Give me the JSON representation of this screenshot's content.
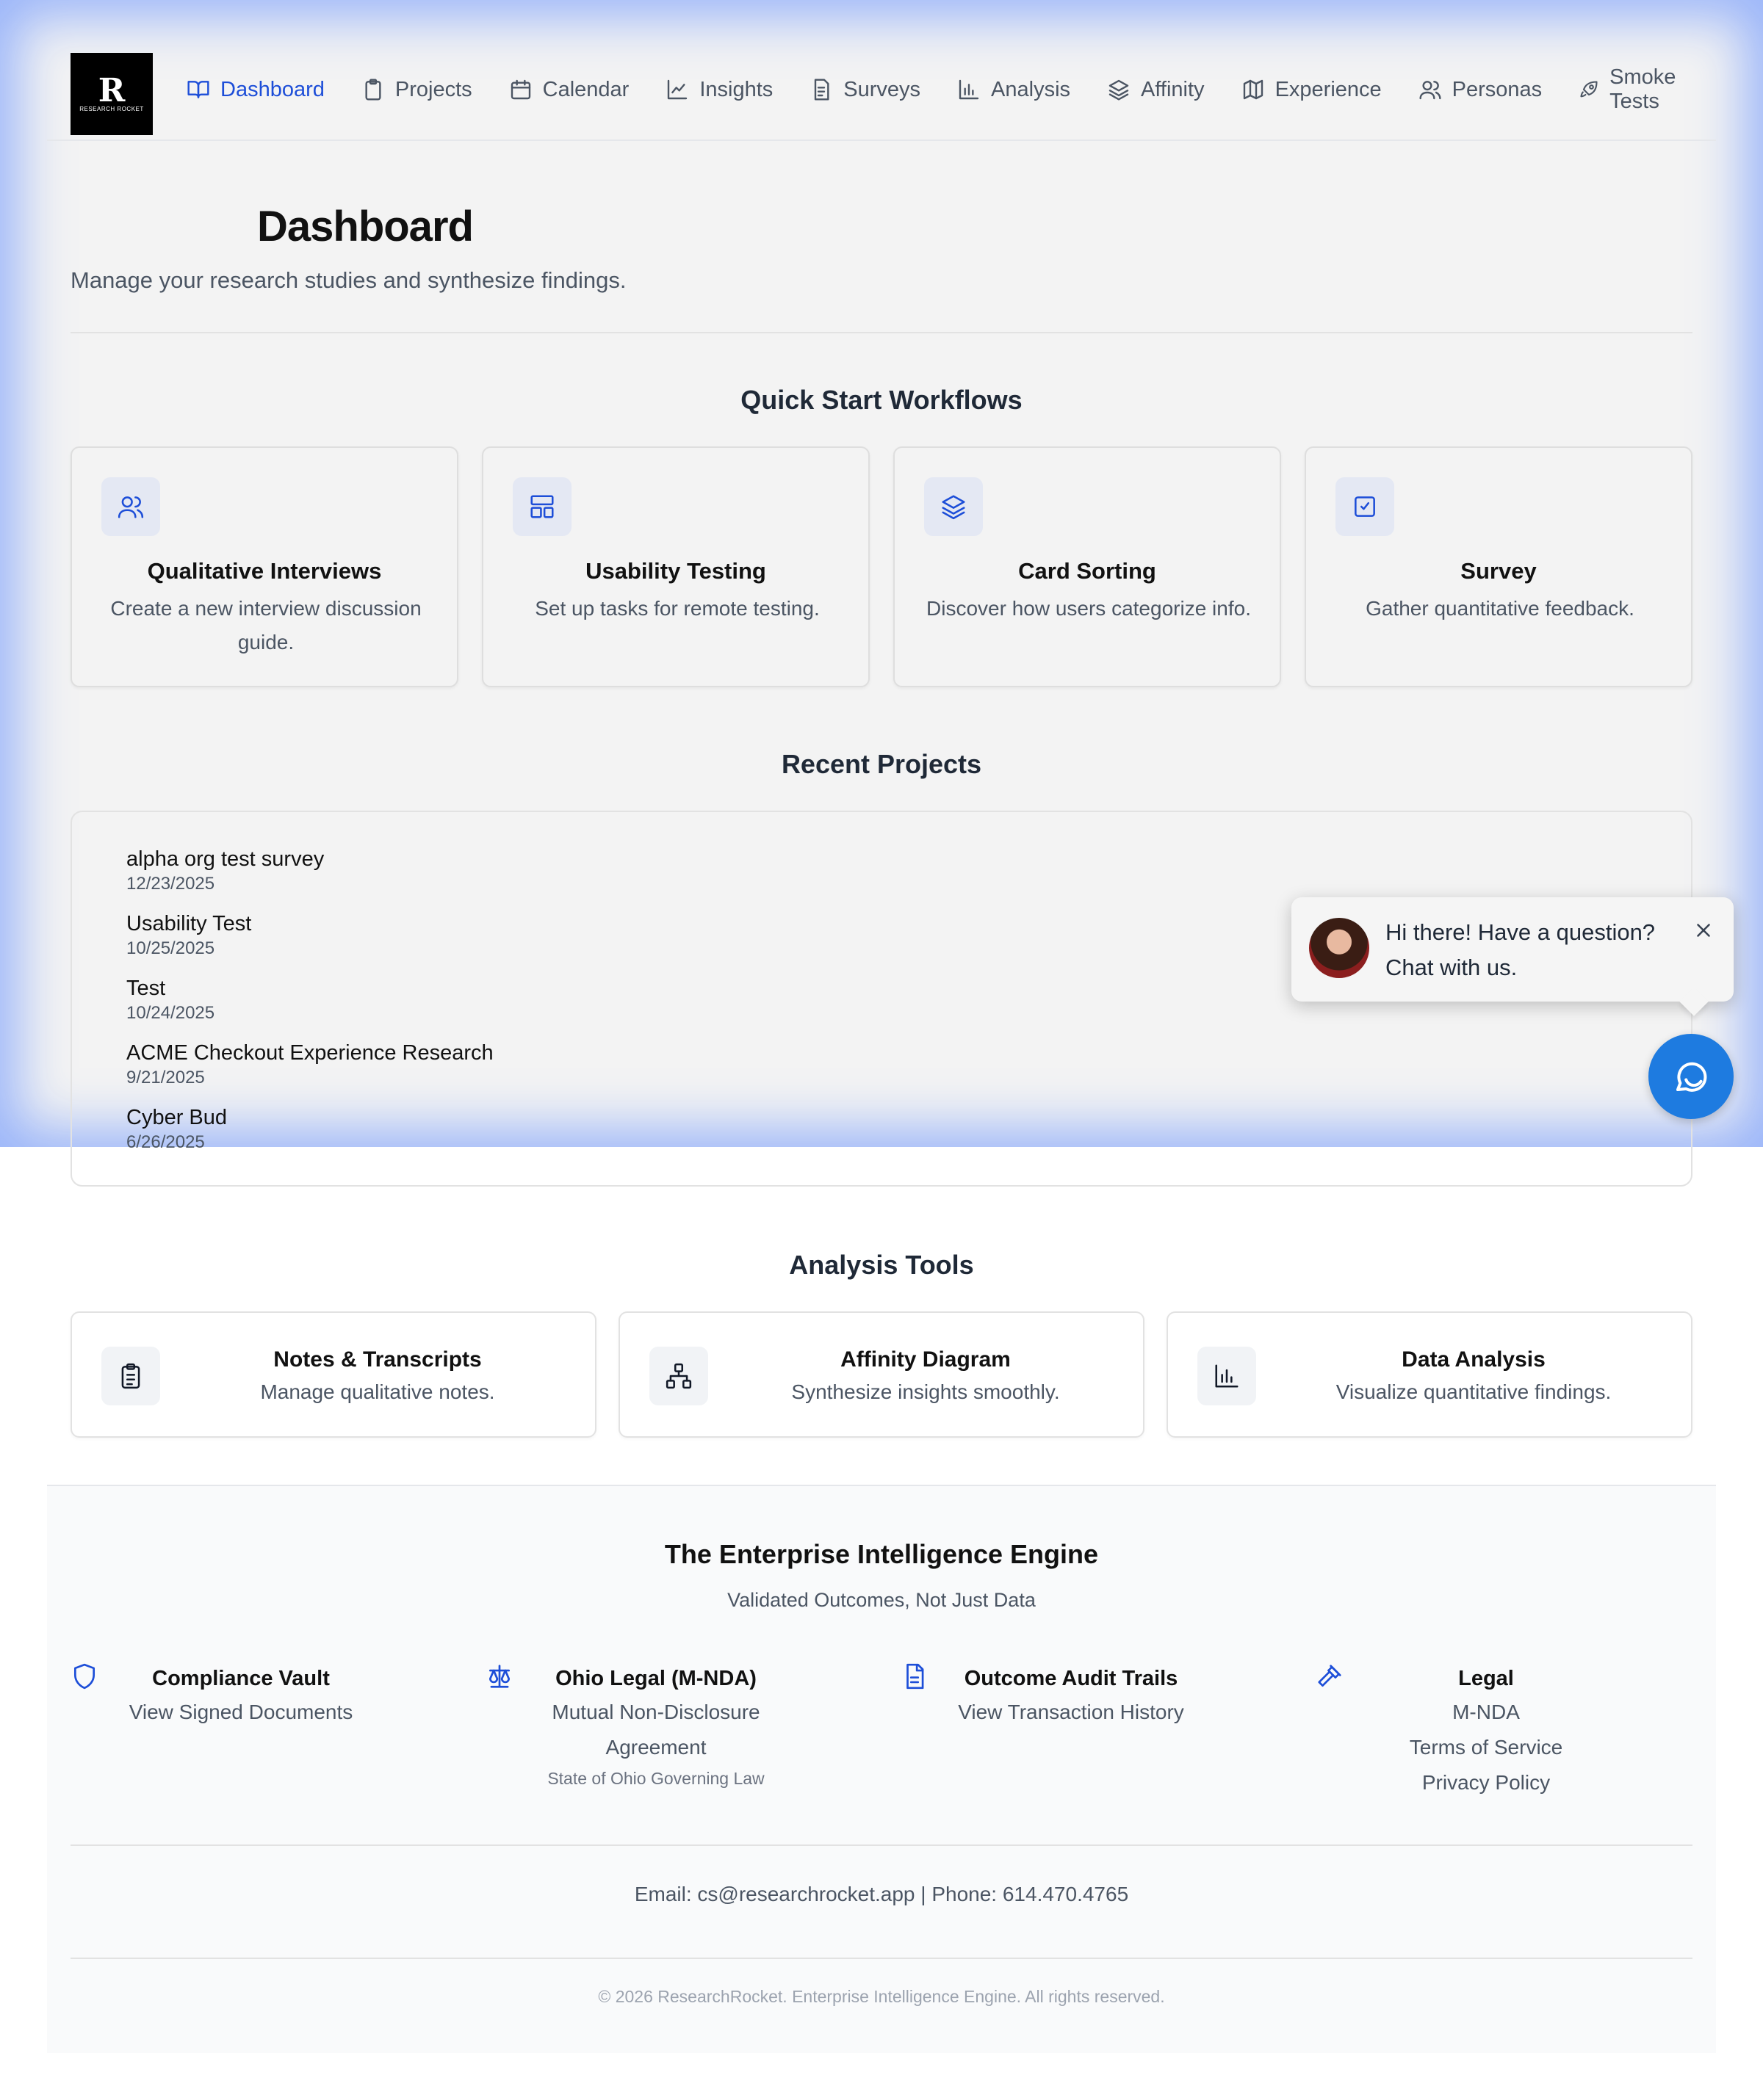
{
  "logo": {
    "mark": "R",
    "text": "RESEARCH ROCKET"
  },
  "nav": [
    {
      "label": "Dashboard",
      "icon": "book-open-icon",
      "active": true
    },
    {
      "label": "Projects",
      "icon": "clipboard-icon"
    },
    {
      "label": "Calendar",
      "icon": "calendar-icon"
    },
    {
      "label": "Insights",
      "icon": "line-chart-icon"
    },
    {
      "label": "Surveys",
      "icon": "file-text-icon"
    },
    {
      "label": "Analysis",
      "icon": "bar-chart-icon"
    },
    {
      "label": "Affinity",
      "icon": "layers-icon"
    },
    {
      "label": "Experience",
      "icon": "map-icon"
    },
    {
      "label": "Personas",
      "icon": "users-icon"
    },
    {
      "label": "Smoke Tests",
      "icon": "rocket-icon"
    }
  ],
  "header": {
    "title": "Dashboard",
    "subtitle": "Manage your research studies and synthesize findings."
  },
  "quick_start": {
    "title": "Quick Start Workflows",
    "cards": [
      {
        "title": "Qualitative Interviews",
        "desc": "Create a new interview discussion guide.",
        "icon": "users-icon"
      },
      {
        "title": "Usability Testing",
        "desc": "Set up tasks for remote testing.",
        "icon": "layout-icon"
      },
      {
        "title": "Card Sorting",
        "desc": "Discover how users categorize info.",
        "icon": "layers-icon"
      },
      {
        "title": "Survey",
        "desc": "Gather quantitative feedback.",
        "icon": "check-square-icon"
      }
    ]
  },
  "recent_projects": {
    "title": "Recent Projects",
    "items": [
      {
        "name": "alpha org test survey",
        "date": "12/23/2025"
      },
      {
        "name": "Usability Test",
        "date": "10/25/2025"
      },
      {
        "name": "Test",
        "date": "10/24/2025"
      },
      {
        "name": "ACME Checkout Experience Research",
        "date": "9/21/2025"
      },
      {
        "name": "Cyber Bud",
        "date": "6/26/2025"
      }
    ]
  },
  "analysis_tools": {
    "title": "Analysis Tools",
    "cards": [
      {
        "title": "Notes & Transcripts",
        "desc": "Manage qualitative notes.",
        "icon": "clipboard-list-icon"
      },
      {
        "title": "Affinity Diagram",
        "desc": "Synthesize insights smoothly.",
        "icon": "network-icon"
      },
      {
        "title": "Data Analysis",
        "desc": "Visualize quantitative findings.",
        "icon": "bar-chart-icon"
      }
    ]
  },
  "footer": {
    "title": "The Enterprise Intelligence Engine",
    "subtitle": "Validated Outcomes, Not Just Data",
    "columns": [
      {
        "head": "Compliance Vault",
        "lines": [
          "View Signed Documents"
        ],
        "small": "",
        "icon": "shield-icon"
      },
      {
        "head": "Ohio Legal (M-NDA)",
        "lines": [
          "Mutual Non-Disclosure Agreement"
        ],
        "small": "State of Ohio Governing Law",
        "icon": "scale-icon"
      },
      {
        "head": "Outcome Audit Trails",
        "lines": [
          "View Transaction History"
        ],
        "small": "",
        "icon": "file-icon"
      },
      {
        "head": "Legal",
        "lines": [
          "M-NDA",
          "Terms of Service",
          "Privacy Policy"
        ],
        "small": "",
        "icon": "gavel-icon"
      }
    ],
    "contact": "Email: cs@researchrocket.app | Phone: 614.470.4765",
    "copyright": "© 2026 ResearchRocket. Enterprise Intelligence Engine. All rights reserved."
  },
  "chat": {
    "message": "Hi there! Have a question? Chat with us."
  },
  "colors": {
    "accent": "#1d4ed8",
    "chat_button": "#1e7be0",
    "glow": "#5082ff"
  }
}
